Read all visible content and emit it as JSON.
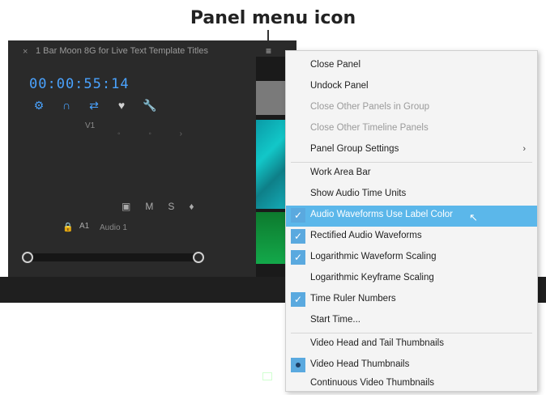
{
  "callout": {
    "title": "Panel menu icon"
  },
  "panel": {
    "close_glyph": "×",
    "sequence_title": "1 Bar Moon 8G for Live Text Template Titles",
    "menu_icon_glyph": "≡",
    "timecode": "00:00:55:14",
    "track_v1": "V1",
    "track_a1": "A1",
    "audio_track_name": "Audio 1",
    "tools": [
      {
        "glyph": "⚙",
        "icon": "settings-icon"
      },
      {
        "glyph": "∩",
        "icon": "magnet-icon"
      },
      {
        "glyph": "⇄",
        "icon": "linked-selection-icon"
      },
      {
        "glyph": "♥",
        "icon": "marker-icon"
      },
      {
        "glyph": "🔧",
        "icon": "wrench-icon"
      }
    ]
  },
  "menu": {
    "items": [
      {
        "label": "Close Panel",
        "state": "normal"
      },
      {
        "label": "Undock Panel",
        "state": "normal"
      },
      {
        "label": "Close Other Panels in Group",
        "state": "disabled"
      },
      {
        "label": "Close Other Timeline Panels",
        "state": "disabled"
      },
      {
        "label": "Panel Group Settings",
        "state": "normal",
        "submenu": true
      },
      {
        "label": "Work Area Bar",
        "state": "normal"
      },
      {
        "label": "Show Audio Time Units",
        "state": "normal"
      },
      {
        "label": "Audio Waveforms Use Label Color",
        "state": "checked",
        "highlight": true
      },
      {
        "label": "Rectified Audio Waveforms",
        "state": "checked"
      },
      {
        "label": "Logarithmic Waveform Scaling",
        "state": "checked"
      },
      {
        "label": "Logarithmic Keyframe Scaling",
        "state": "normal"
      },
      {
        "label": "Time Ruler Numbers",
        "state": "checked"
      },
      {
        "label": "Start Time...",
        "state": "normal"
      },
      {
        "label": "Video Head and Tail Thumbnails",
        "state": "normal"
      },
      {
        "label": "Video Head Thumbnails",
        "state": "radio"
      },
      {
        "label": "Continuous Video Thumbnails",
        "state": "normal"
      }
    ],
    "submenu_arrow": "›",
    "check_glyph": "✓"
  },
  "colors": {
    "accent": "#4aa3ff",
    "highlight": "#5bb7ea",
    "panel_bg": "#2a2a2a",
    "menu_bg": "#f4f4f4"
  }
}
